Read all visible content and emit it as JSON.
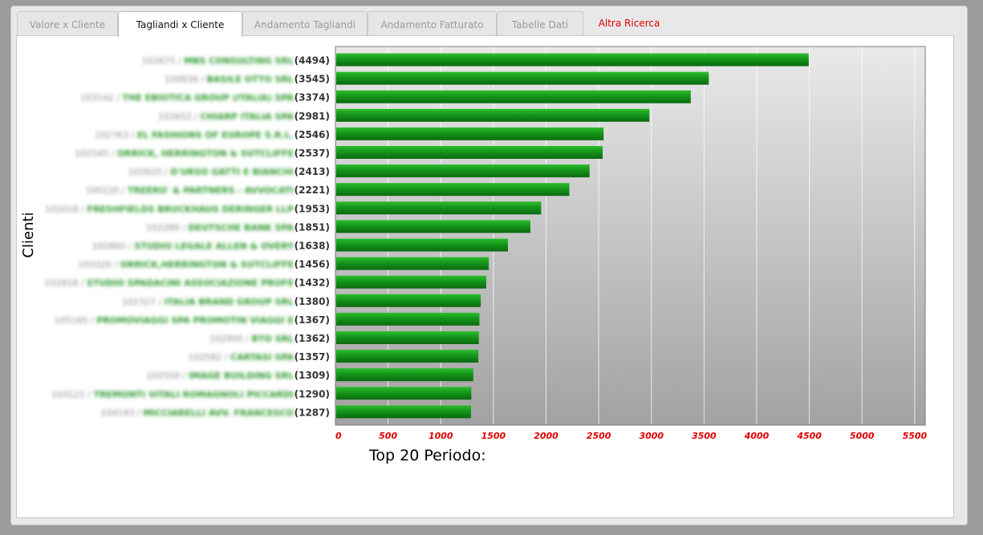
{
  "tabs": [
    {
      "label": "Valore x Cliente",
      "state": "inactive"
    },
    {
      "label": "Tagliandi x Cliente",
      "state": "active"
    },
    {
      "label": "Andamento Tagliandi",
      "state": "inactive"
    },
    {
      "label": "Andamento Fatturato",
      "state": "inactive"
    },
    {
      "label": "Tabelle Dati",
      "state": "inactive"
    },
    {
      "label": "Altra Ricerca",
      "state": "link"
    }
  ],
  "colors": {
    "bar": "#1a9a1a",
    "tick_label": "#e00000",
    "link": "#e00000"
  },
  "chart_data": {
    "type": "bar",
    "orientation": "horizontal",
    "ylabel": "Clienti",
    "title": "Top 20 Periodo:",
    "xlim": [
      0,
      5600
    ],
    "xticks": [
      0,
      500,
      1000,
      1500,
      2000,
      2500,
      3000,
      3500,
      4000,
      4500,
      5000,
      5500
    ],
    "grid": true,
    "categories": [
      {
        "code": "102675",
        "name": "MBS CONSULTING SRL"
      },
      {
        "code": "100838",
        "name": "BASILE OTTO SRL"
      },
      {
        "code": "103142",
        "name": "THE EBIOTICA GROUP (ITALIA) SPA"
      },
      {
        "code": "102652",
        "name": "CHIARP ITALIA SPA"
      },
      {
        "code": "102763",
        "name": "EL FASHIONS OF EUROPE S.R.L."
      },
      {
        "code": "102545",
        "name": "ORRICK, HERRINGTON & SUTCLIFFE"
      },
      {
        "code": "102620",
        "name": "D'URSO GATTI E BIANCHI"
      },
      {
        "code": "100220",
        "name": "TREERO' & PARTNERS - AVVOCATI"
      },
      {
        "code": "102018",
        "name": "FRESHFIELDS BRUCKHAUS DERINGER LLP"
      },
      {
        "code": "102289",
        "name": "DEUTSCHE BANK SPA"
      },
      {
        "code": "102860",
        "name": "STUDIO LEGALE ALLEN & OVERY"
      },
      {
        "code": "103326",
        "name": "ORRICK,HERRINGTON & SUTCLIFFE"
      },
      {
        "code": "102818",
        "name": "STUDIO SPADACINI ASSOCIAZIONE PROFE"
      },
      {
        "code": "102327",
        "name": "ITALIA BRAND GROUP SRL"
      },
      {
        "code": "105165",
        "name": "PROMOVIAGGI SPA PROMOTIN VIAGGI E"
      },
      {
        "code": "102950",
        "name": "BTO SRL"
      },
      {
        "code": "102582",
        "name": "CARTASI SPA"
      },
      {
        "code": "102550",
        "name": "IMAGE BUILDING SRL"
      },
      {
        "code": "103121",
        "name": "TREMONTI VITALI ROMAGNOLI PICCARDI"
      },
      {
        "code": "104193",
        "name": "MICCIARELLI AVV. FRANCESCO"
      }
    ],
    "values": [
      4494,
      3545,
      3374,
      2981,
      2546,
      2537,
      2413,
      2221,
      1953,
      1851,
      1638,
      1456,
      1432,
      1380,
      1367,
      1362,
      1357,
      1309,
      1290,
      1287
    ]
  }
}
